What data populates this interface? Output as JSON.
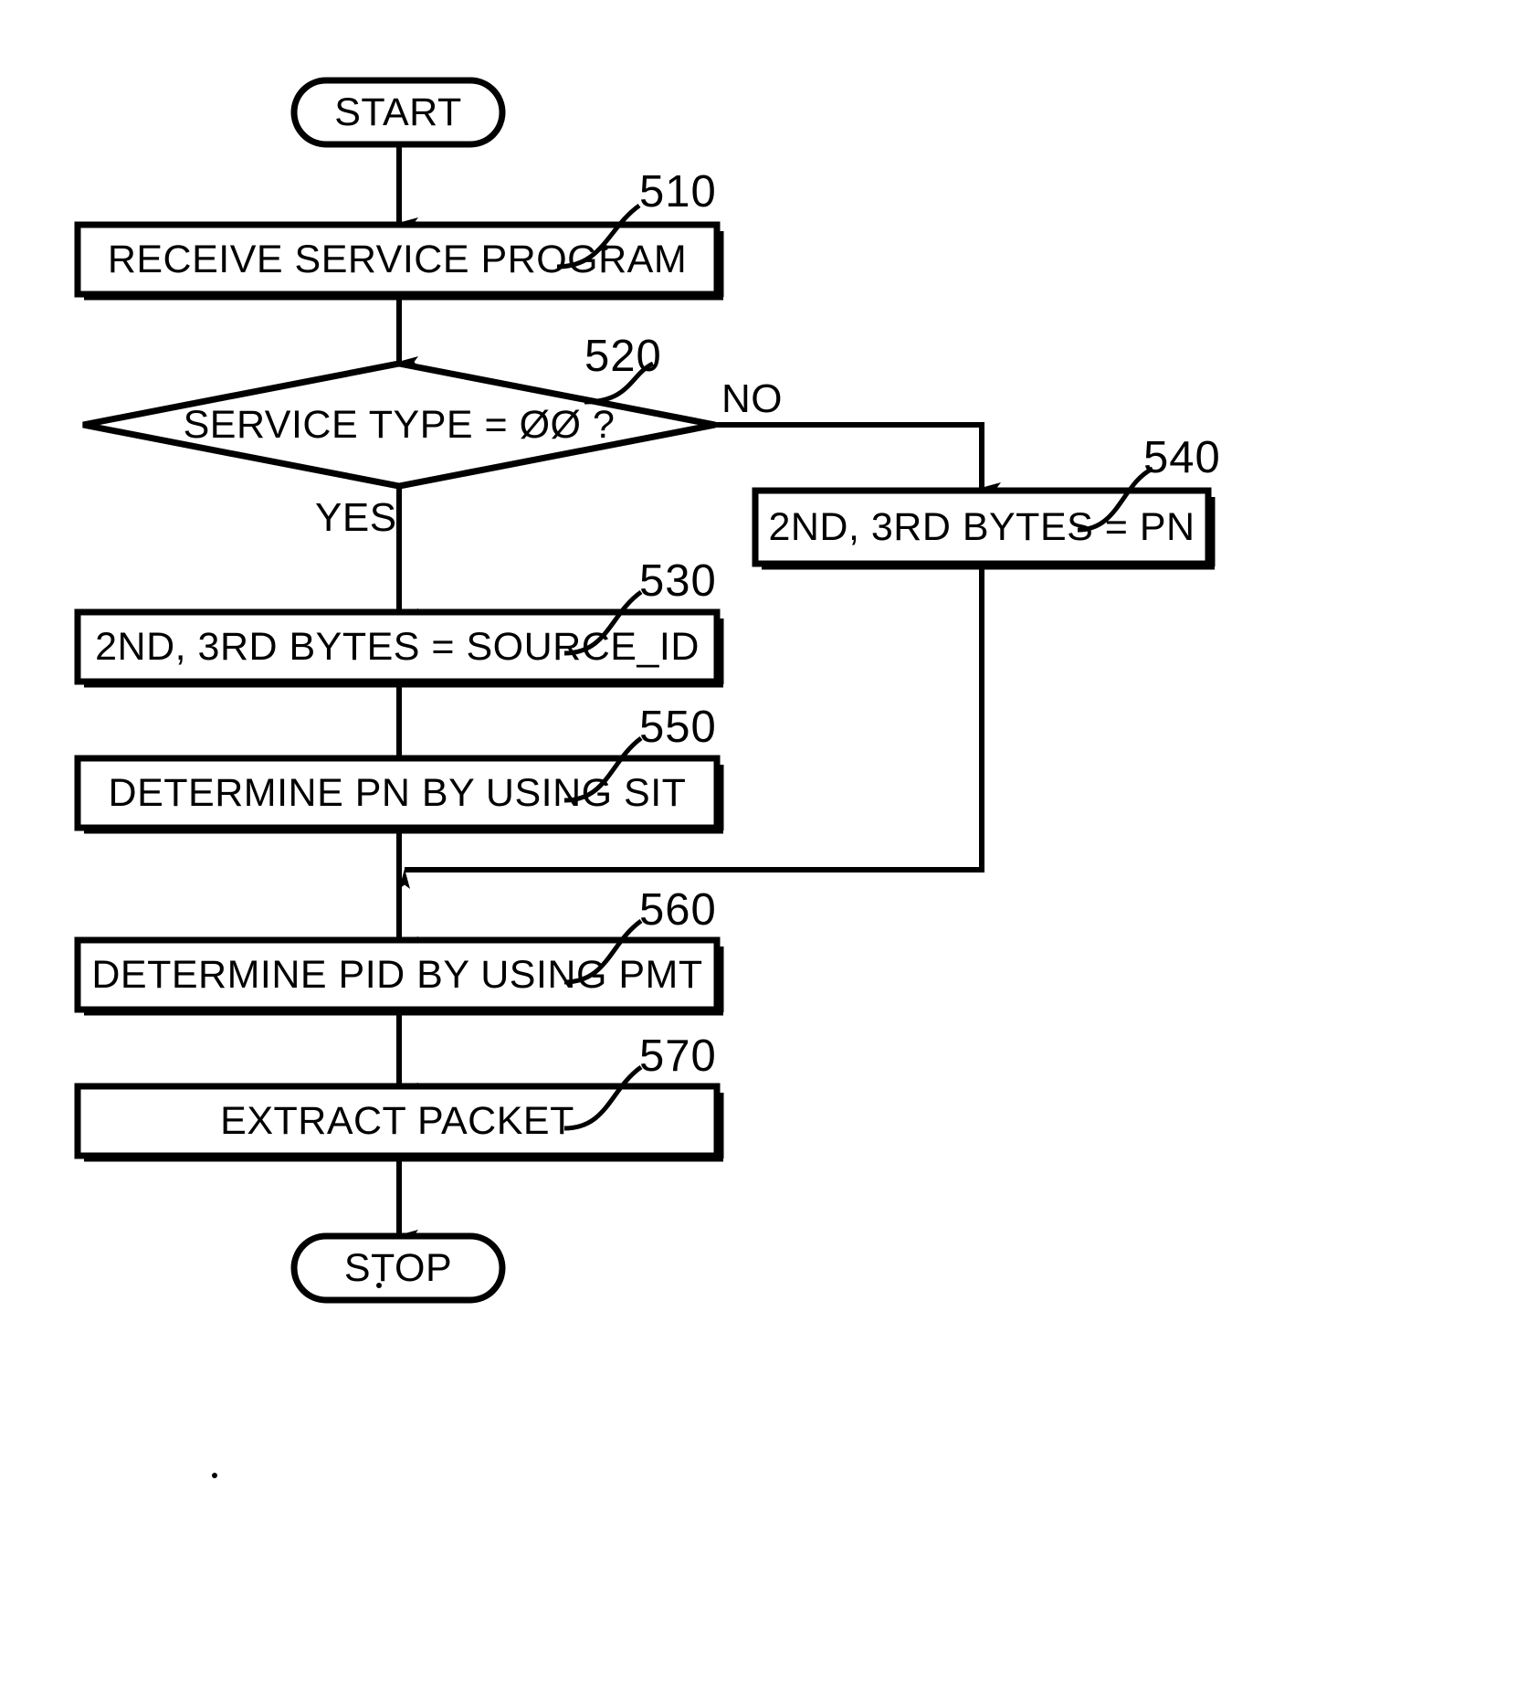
{
  "diagram": {
    "type": "flowchart",
    "title": "",
    "nodes": [
      {
        "id": "start",
        "shape": "terminator",
        "label": "START",
        "ref": ""
      },
      {
        "id": "n510",
        "shape": "process",
        "label": "RECEIVE SERVICE PROGRAM",
        "ref": "510"
      },
      {
        "id": "n520",
        "shape": "decision",
        "label": "SERVICE TYPE = ØØ ?",
        "ref": "520"
      },
      {
        "id": "n540",
        "shape": "process",
        "label": "2ND, 3RD BYTES = PN",
        "ref": "540"
      },
      {
        "id": "n530",
        "shape": "process",
        "label": "2ND, 3RD BYTES = SOURCE_ID",
        "ref": "530"
      },
      {
        "id": "n550",
        "shape": "process",
        "label": "DETERMINE PN BY USING SIT",
        "ref": "550"
      },
      {
        "id": "n560",
        "shape": "process",
        "label": "DETERMINE PID BY USING PMT",
        "ref": "560"
      },
      {
        "id": "n570",
        "shape": "process",
        "label": "EXTRACT PACKET",
        "ref": "570"
      },
      {
        "id": "stop",
        "shape": "terminator",
        "label": "STOP",
        "ref": ""
      }
    ],
    "edge_labels": {
      "no": "NO",
      "yes": "YES"
    },
    "edges": [
      {
        "from": "start",
        "to": "n510",
        "label": ""
      },
      {
        "from": "n510",
        "to": "n520",
        "label": ""
      },
      {
        "from": "n520",
        "to": "n540",
        "label": "NO"
      },
      {
        "from": "n520",
        "to": "n530",
        "label": "YES"
      },
      {
        "from": "n530",
        "to": "n550",
        "label": ""
      },
      {
        "from": "n550",
        "to": "n560",
        "label": ""
      },
      {
        "from": "n540",
        "to": "n560",
        "label": ""
      },
      {
        "from": "n560",
        "to": "n570",
        "label": ""
      },
      {
        "from": "n570",
        "to": "stop",
        "label": ""
      }
    ],
    "style": {
      "stroke": "#000000",
      "fill": "#ffffff",
      "background": "#ffffff"
    }
  }
}
